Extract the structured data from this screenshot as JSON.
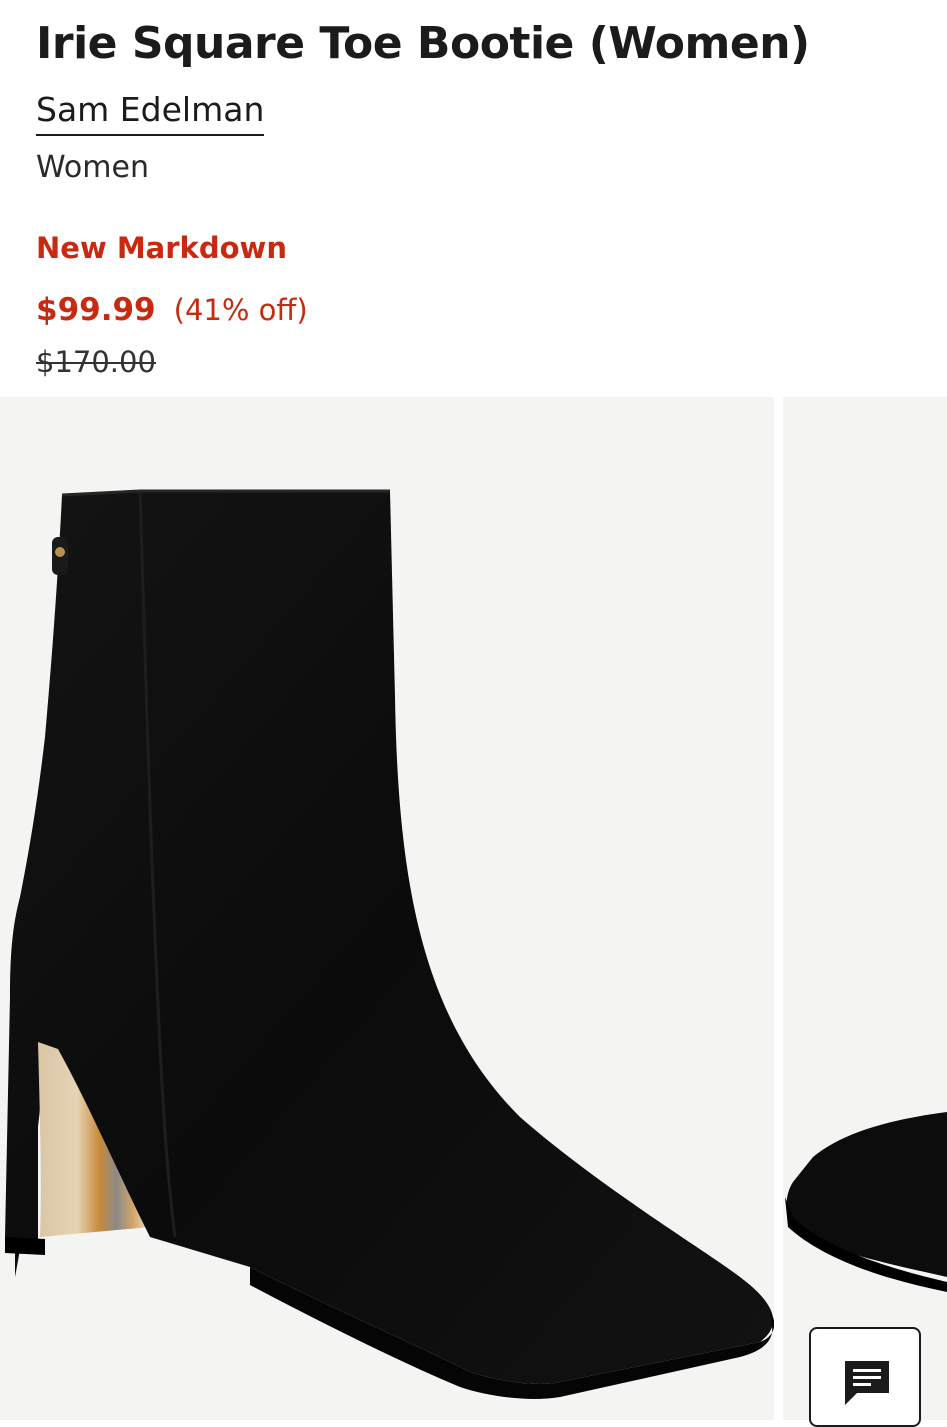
{
  "product": {
    "title": "Irie Square Toe Bootie (Women)",
    "brand": "Sam Edelman",
    "category": "Women"
  },
  "pricing": {
    "badge": "New Markdown",
    "sale_price": "$99.99",
    "discount": "(41% off)",
    "original_price": "$170.00"
  },
  "gallery": {
    "main_image": "black-suede-square-toe-ankle-boot",
    "next_image": "black-boot-toe-partial"
  },
  "chat": {
    "icon": "chat-message-icon"
  },
  "colors": {
    "sale": "#c8290f",
    "text": "#1b1b1b",
    "image_background": "#f4f4f3"
  }
}
